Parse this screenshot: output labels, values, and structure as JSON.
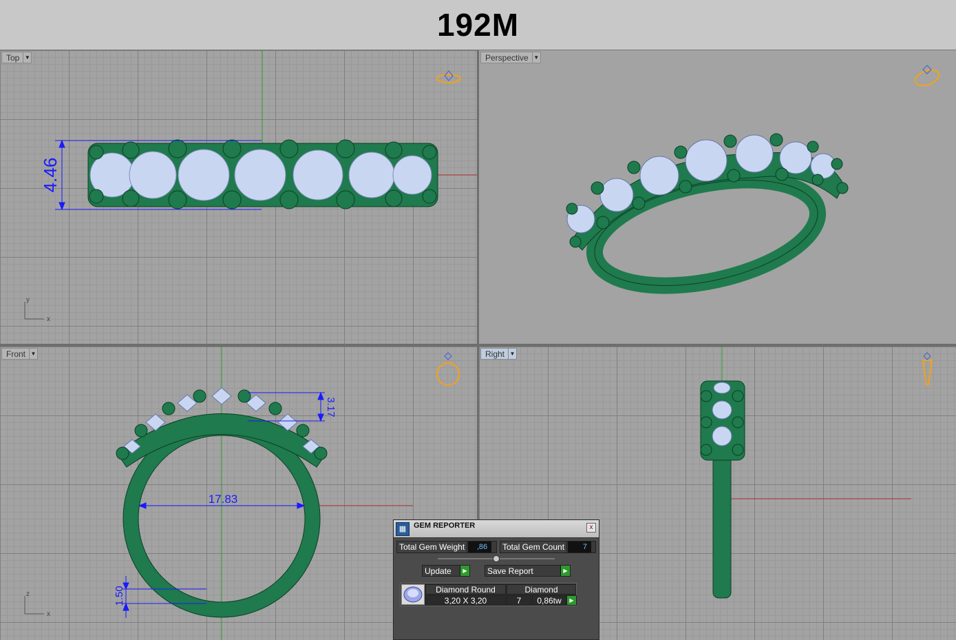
{
  "header": {
    "title": "192M"
  },
  "viewports": {
    "top": {
      "label": "Top",
      "dimension": "4.46",
      "axis_x": "x",
      "axis_y": "y"
    },
    "perspective": {
      "label": "Perspective"
    },
    "front": {
      "label": "Front",
      "dim_width": "17.83",
      "dim_height": "3.17",
      "dim_band": "1.50",
      "axis_x": "x",
      "axis_z": "z"
    },
    "right": {
      "label": "Right"
    }
  },
  "gem_reporter": {
    "title": "GEM REPORTER",
    "close_glyph": "x",
    "total_weight_label": "Total Gem Weight",
    "total_weight_value": ",86",
    "total_count_label": "Total Gem Count",
    "total_count_value": "7",
    "update_label": "Update",
    "save_report_label": "Save Report",
    "table": {
      "col1_header": "Diamond Round",
      "col2_header": "Diamond",
      "size": "3,20 X 3,20",
      "count": "7",
      "weight": "0,86tw"
    }
  },
  "colors": {
    "metal": "#1f7a4d",
    "gem": "#c9d6f2",
    "dimension": "#1a1aff",
    "icon": "#f2a21b"
  }
}
